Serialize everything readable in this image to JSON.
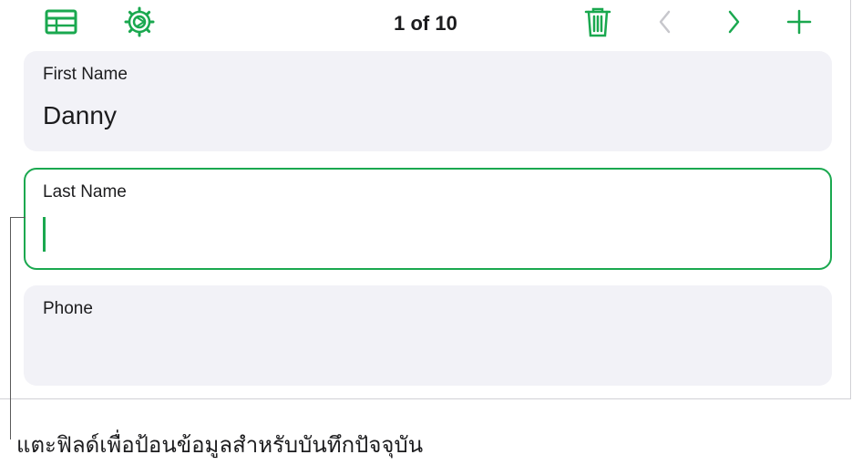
{
  "toolbar": {
    "table_view_icon": "table-grid-icon",
    "settings_icon": "gear-icon",
    "record_counter": "1 of 10",
    "delete_icon": "trash-icon",
    "previous_icon": "chevron-left-icon",
    "next_icon": "chevron-right-icon",
    "add_icon": "plus-icon"
  },
  "fields": [
    {
      "label": "First Name",
      "value": "Danny",
      "active": false
    },
    {
      "label": "Last Name",
      "value": "",
      "active": true
    },
    {
      "label": "Phone",
      "value": "",
      "active": false
    }
  ],
  "callout": {
    "text": "แตะฟิลด์เพื่อป้อนข้อมูลสำหรับบันทึกปัจจุบัน"
  },
  "colors": {
    "accent": "#1aa84f",
    "disabled": "#c7c7cc",
    "field_background": "#f2f2f7",
    "text": "#1c1c1e"
  }
}
